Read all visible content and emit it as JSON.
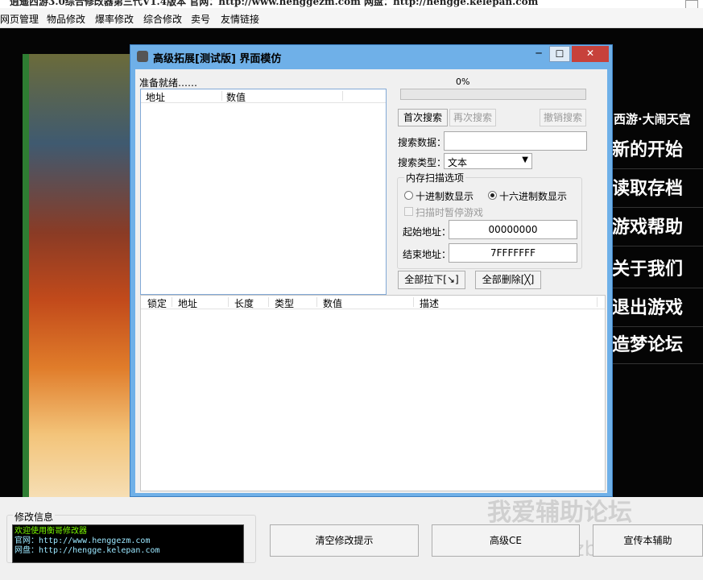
{
  "window": {
    "title_fragment": "逍遥西游3.0综合修改器第三代V1.4版本  官网：http://www.henggezm.com  网盘：http://hengge.kelepan.com"
  },
  "menubar": [
    "网页管理",
    "物品修改",
    "爆率修改",
    "综合修改",
    "卖号",
    "友情链接"
  ],
  "right_menu": {
    "slogan": "西游·大闹天宫",
    "items": [
      "新的开始",
      "读取存档",
      "游戏帮助",
      "关于我们",
      "退出游戏",
      "造梦论坛"
    ]
  },
  "dialog": {
    "title": "高级拓展[测试版] 界面模仿",
    "status": "准备就绪……",
    "progress_text": "0%",
    "progress_value": 0,
    "list_top": {
      "columns": [
        "地址",
        "数值"
      ]
    },
    "buttons": {
      "first_search": "首次搜索",
      "research": "再次搜索",
      "cancel_search": "撤销搜索",
      "pull_all": "全部拉下[↘]",
      "delete_all": "全部删除[╳]"
    },
    "search_data_label": "搜索数据：",
    "search_data_value": "",
    "search_type_label": "搜索类型：",
    "search_type_value": "文本",
    "scan_group": {
      "title": "内存扫描选项",
      "radio_dec": "十进制数显示",
      "radio_hex": "十六进制数显示",
      "pause_game": "扫描时暂停游戏",
      "start_label": "起始地址：",
      "start_value": "00000000",
      "end_label": "结束地址：",
      "end_value": "7FFFFFFF"
    },
    "list_bottom": {
      "columns": [
        "锁定",
        "地址",
        "长度",
        "类型",
        "数值",
        "描述"
      ]
    }
  },
  "bottom": {
    "info_title": "修改信息",
    "console": [
      "欢迎使用衡哥修改器",
      "官网：http://www.henggezm.com",
      "网盘：http://hengge.kelepan.com"
    ],
    "buttons": {
      "clear": "清空修改提示",
      "advanced": "高级CE",
      "promote": "宣传本辅助"
    },
    "watermark1": "我爱辅助论坛",
    "watermark2": "www.52fzba.com"
  },
  "colors": {
    "titlebar": "#6fb0e8",
    "close": "#c7413b",
    "console_green": "#7cfc00",
    "console_cyan": "#9be7ff"
  }
}
